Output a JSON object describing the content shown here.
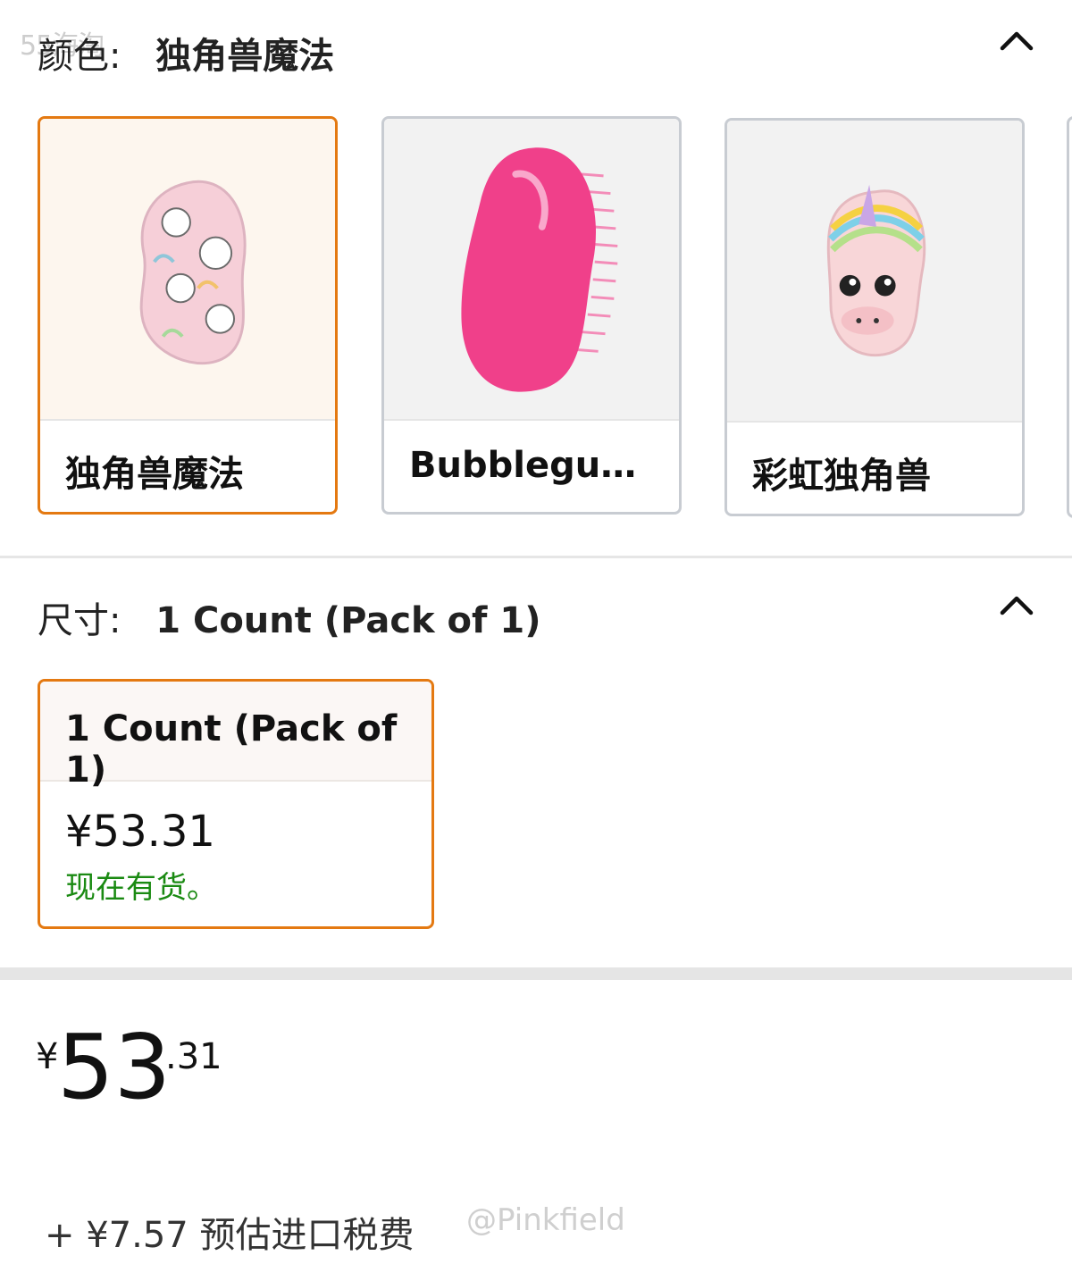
{
  "watermark_top": "55海淘",
  "color_section": {
    "label": "颜色:",
    "selected_value": "独角兽魔法",
    "options": [
      {
        "name": "独角兽魔法",
        "selected": true
      },
      {
        "name": "Bubblegum…",
        "selected": false
      },
      {
        "name": "彩虹独角兽",
        "selected": false
      }
    ]
  },
  "size_section": {
    "label": "尺寸:",
    "selected_value": "1 Count (Pack of 1)",
    "card": {
      "title": "1 Count (Pack of 1)",
      "price": "¥53.31",
      "stock": "现在有货。"
    }
  },
  "price": {
    "currency": "¥",
    "whole": "53",
    "fraction": ".31"
  },
  "import_fee": "+ ¥7.57 预估进口税费",
  "watermark_bottom": "@Pinkfield",
  "colors": {
    "selected_border": "#e47911",
    "unselected_border": "#c8ccd2",
    "in_stock": "#1a8a12",
    "bubblegum_pink": "#f0408a",
    "unicorn_pink": "#f6cfd8"
  }
}
